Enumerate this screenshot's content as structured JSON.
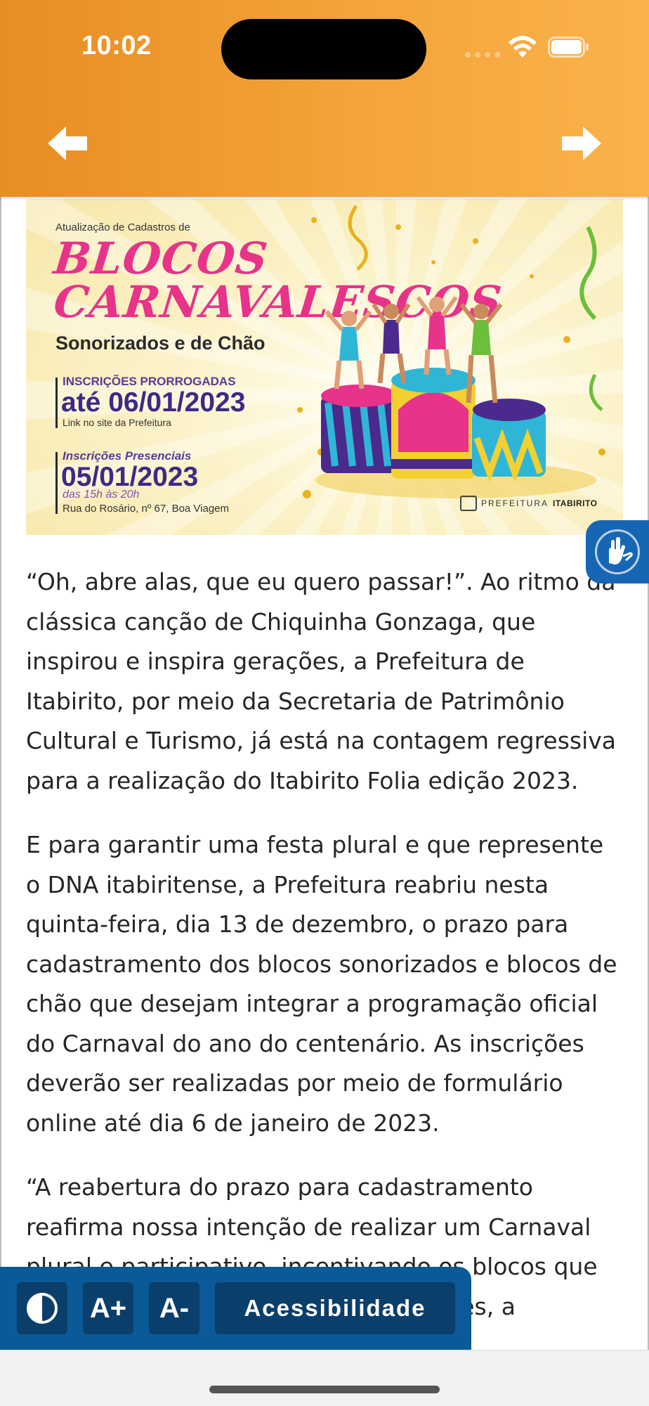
{
  "status_bar": {
    "time": "10:02"
  },
  "colors": {
    "header_gradient_start": "#e88d22",
    "header_gradient_end": "#fbb24b",
    "accessibility_bar": "#0b5a97",
    "accessibility_button": "#0b3f6b",
    "libras_button": "#1766b3",
    "banner_title": "#e7338a",
    "banner_date": "#3d2a86"
  },
  "header": {
    "back_icon": "arrow-left-icon",
    "forward_icon": "arrow-right-icon"
  },
  "banner": {
    "small_heading": "Atualização de Cadastros de",
    "title_line1": "BLOCOS",
    "title_line2": "CARNAVALESCOS",
    "subtitle": "Sonorizados e de Chão",
    "inscricoes_label": "INSCRIÇÕES PRORROGADAS",
    "deadline": "até 06/01/2023",
    "link_note": "Link no site da Prefeitura",
    "presencial_label": "Inscrições Presenciais",
    "presencial_date": "05/01/2023",
    "presencial_hours": "das 15h às 20h",
    "address": "Rua do Rosário, nº 67, Boa Viagem",
    "logo_prefix": "PREFEITURA",
    "logo_name": "ITABIRITO"
  },
  "article": {
    "paragraphs": [
      "“Oh, abre alas, que eu quero passar!”. Ao ritmo da clássica canção de Chiquinha Gonzaga, que inspirou e inspira gerações, a Prefeitura de Itabirito, por meio da Secretaria de Patrimônio Cultural e Turismo, já está na contagem regressiva para a realização do Itabirito Folia edição 2023.",
      "E para garantir uma festa plural e que represente o DNA itabiritense, a Prefeitura reabriu nesta quinta-feira, dia 13 de dezembro, o prazo para cadastramento dos blocos sonorizados e blocos de chão que desejam integrar a programação oficial do Carnaval do ano do centenário. As inscrições deverão ser realizadas por meio de formulário online até dia 6 de janeiro de 2023.",
      "“A reabertura do prazo para cadastramento reafirma nossa intenção de realizar um Carnaval plural e participativo, incentivando os blocos que já tradicionalmente fazem seus desfiles, a"
    ]
  },
  "libras": {
    "icon": "sign-language-hands-icon"
  },
  "accessibility_bar": {
    "contrast_icon": "contrast-icon",
    "increase_font": "A+",
    "decrease_font": "A-",
    "label": "Acessibilidade"
  }
}
